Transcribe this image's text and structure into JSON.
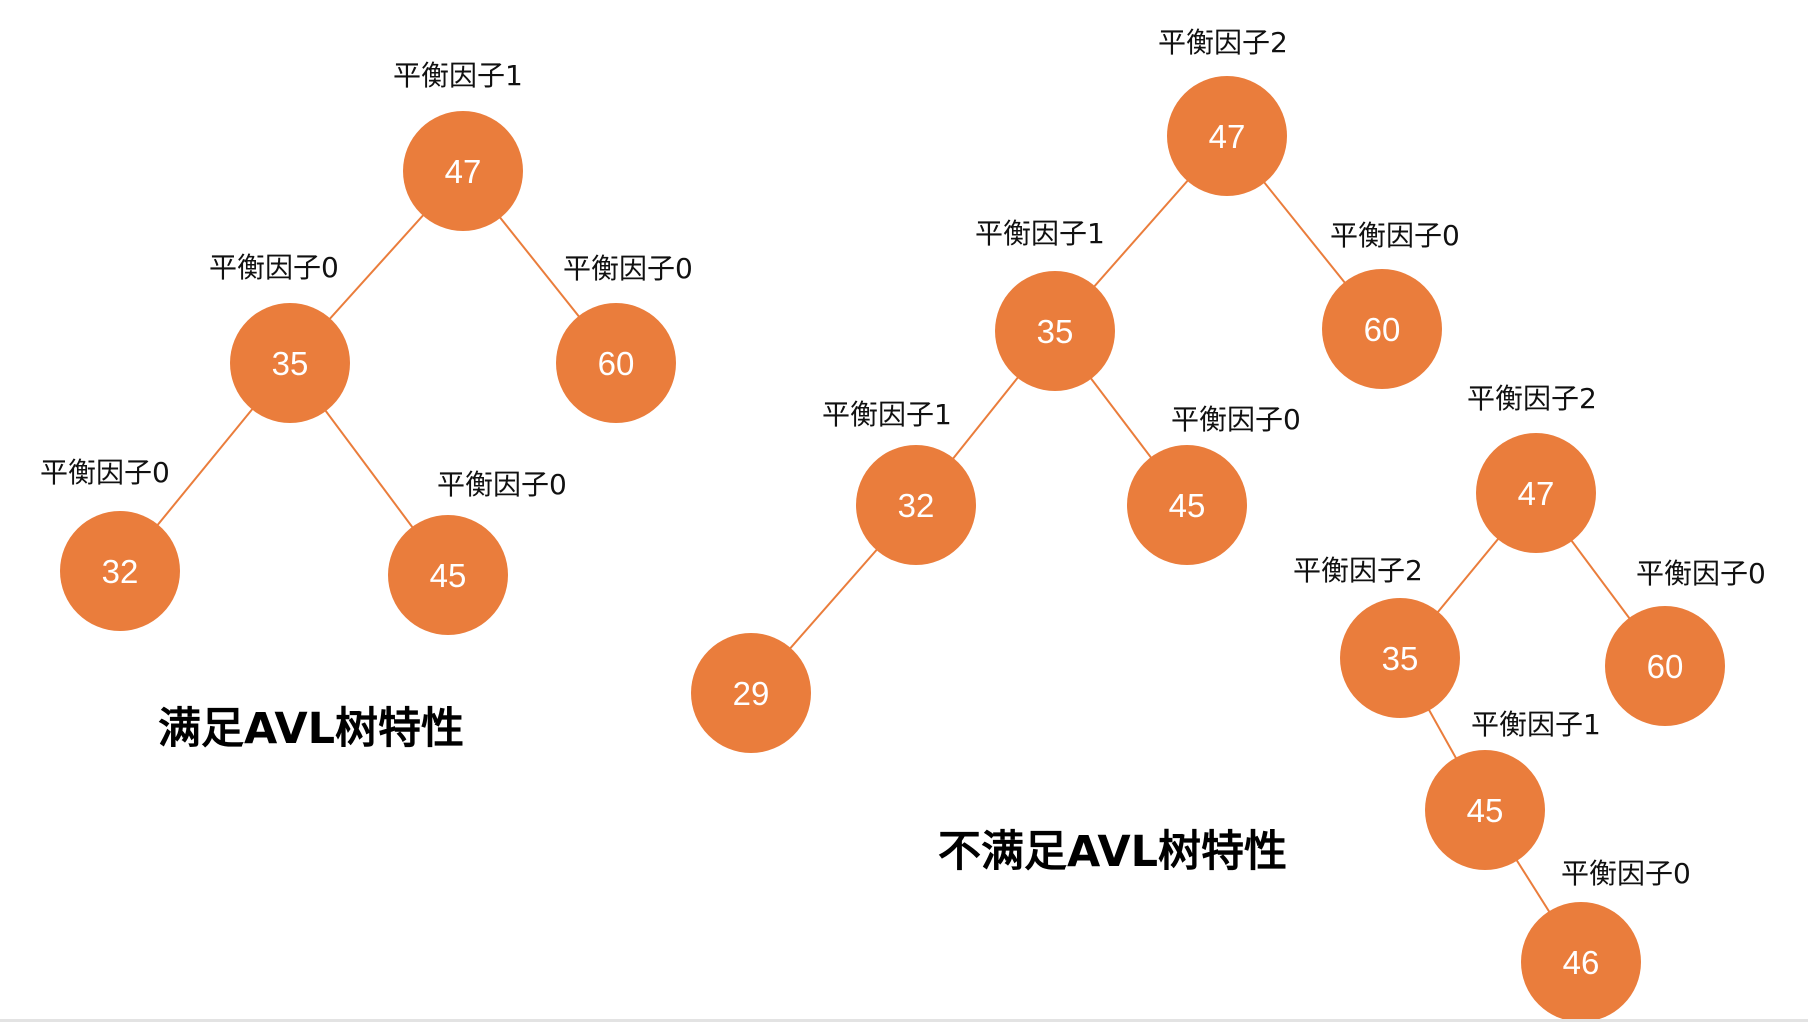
{
  "colors": {
    "node_fill": "#ea7d3c",
    "node_text": "#ffffff",
    "edge": "#ea7d3c",
    "label_text": "#111111",
    "caption_text": "#000000"
  },
  "diagrams": [
    {
      "id": "valid",
      "caption": "满足AVL树特性",
      "nodes": [
        {
          "id": "v47",
          "value": "47",
          "balance_label": "平衡因子1"
        },
        {
          "id": "v35",
          "value": "35",
          "balance_label": "平衡因子0"
        },
        {
          "id": "v60",
          "value": "60",
          "balance_label": "平衡因子0"
        },
        {
          "id": "v32",
          "value": "32",
          "balance_label": "平衡因子0"
        },
        {
          "id": "v45",
          "value": "45",
          "balance_label": "平衡因子0"
        }
      ],
      "edges": [
        [
          "v47",
          "v35"
        ],
        [
          "v47",
          "v60"
        ],
        [
          "v35",
          "v32"
        ],
        [
          "v35",
          "v45"
        ]
      ]
    },
    {
      "id": "invalid",
      "caption": "不满足AVL树特性",
      "trees": [
        {
          "nodes": [
            {
              "id": "a47",
              "value": "47",
              "balance_label": "平衡因子2"
            },
            {
              "id": "a35",
              "value": "35",
              "balance_label": "平衡因子1"
            },
            {
              "id": "a60",
              "value": "60",
              "balance_label": "平衡因子0"
            },
            {
              "id": "a32",
              "value": "32",
              "balance_label": "平衡因子1"
            },
            {
              "id": "a45",
              "value": "45",
              "balance_label": "平衡因子0"
            },
            {
              "id": "a29",
              "value": "29",
              "balance_label": ""
            }
          ],
          "edges": [
            [
              "a47",
              "a35"
            ],
            [
              "a47",
              "a60"
            ],
            [
              "a35",
              "a32"
            ],
            [
              "a35",
              "a45"
            ],
            [
              "a32",
              "a29"
            ]
          ]
        },
        {
          "nodes": [
            {
              "id": "b47",
              "value": "47",
              "balance_label": "平衡因子2"
            },
            {
              "id": "b35",
              "value": "35",
              "balance_label": "平衡因子2"
            },
            {
              "id": "b60",
              "value": "60",
              "balance_label": "平衡因子0"
            },
            {
              "id": "b45",
              "value": "45",
              "balance_label": "平衡因子1"
            },
            {
              "id": "b46",
              "value": "46",
              "balance_label": "平衡因子0"
            }
          ],
          "edges": [
            [
              "b47",
              "b35"
            ],
            [
              "b47",
              "b60"
            ],
            [
              "b35",
              "b45"
            ],
            [
              "b45",
              "b46"
            ]
          ]
        }
      ]
    }
  ]
}
